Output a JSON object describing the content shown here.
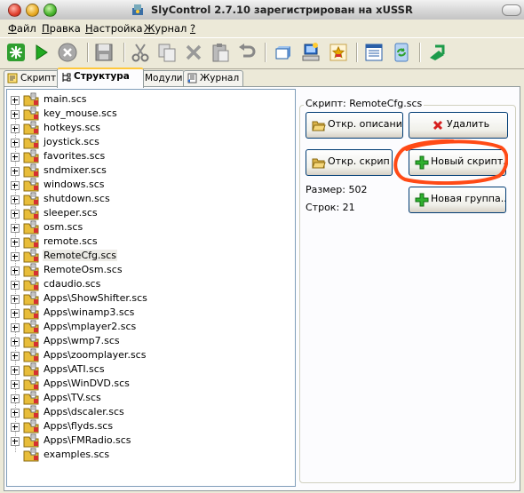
{
  "window": {
    "title": "SlyControl 2.7.10 зарегистрирован на xUSSR"
  },
  "menu": [
    {
      "label_u": "Ф",
      "label_rest": "айл"
    },
    {
      "label_u": "П",
      "label_rest": "равка"
    },
    {
      "label_u": "Н",
      "label_rest": "астройка"
    },
    {
      "label_u": "Ж",
      "label_rest": "урнал"
    },
    {
      "label_u": "?",
      "label_rest": ""
    }
  ],
  "toolbar": {
    "icons": [
      "options-icon",
      "play-icon",
      "stop-icon",
      "save-icon",
      "cut-icon",
      "copy-icon",
      "delete-icon",
      "paste-icon",
      "undo-icon",
      "window-icon",
      "computer-icon",
      "favorite-icon",
      "list-icon",
      "refresh-icon",
      "exit-icon"
    ]
  },
  "tabs": [
    {
      "label": "Скрипт"
    },
    {
      "label": "Структура"
    },
    {
      "label": "Модули"
    },
    {
      "label": "Журнал"
    }
  ],
  "tree": {
    "items": [
      {
        "label": "main.scs"
      },
      {
        "label": "key_mouse.scs"
      },
      {
        "label": "hotkeys.scs"
      },
      {
        "label": "joystick.scs"
      },
      {
        "label": "favorites.scs"
      },
      {
        "label": "sndmixer.scs"
      },
      {
        "label": "windows.scs"
      },
      {
        "label": "shutdown.scs"
      },
      {
        "label": "sleeper.scs"
      },
      {
        "label": "osm.scs"
      },
      {
        "label": "remote.scs"
      },
      {
        "label": "RemoteCfg.scs"
      },
      {
        "label": "RemoteOsm.scs"
      },
      {
        "label": "cdaudio.scs"
      },
      {
        "label": "Apps\\ShowShifter.scs"
      },
      {
        "label": "Apps\\winamp3.scs"
      },
      {
        "label": "Apps\\mplayer2.scs"
      },
      {
        "label": "Apps\\wmp7.scs"
      },
      {
        "label": "Apps\\zoomplayer.scs"
      },
      {
        "label": "Apps\\ATI.scs"
      },
      {
        "label": "Apps\\WinDVD.scs"
      },
      {
        "label": "Apps\\TV.scs"
      },
      {
        "label": "Apps\\dscaler.scs"
      },
      {
        "label": "Apps\\flyds.scs"
      },
      {
        "label": "Apps\\FMRadio.scs"
      },
      {
        "label": "examples.scs"
      }
    ]
  },
  "panel": {
    "title": "Скрипт: RemoteCfg.scs",
    "open_desc": "Откр. описание.",
    "delete": "Удалить",
    "open_script": "Откр. скрип",
    "new_script": "Новый скрипт...",
    "size": "Размер: 502",
    "lines": "Строк: 21",
    "new_group": "Новая группа..."
  },
  "colors": {
    "annotation": "#ff4a16",
    "selection": "#ecebe6"
  }
}
